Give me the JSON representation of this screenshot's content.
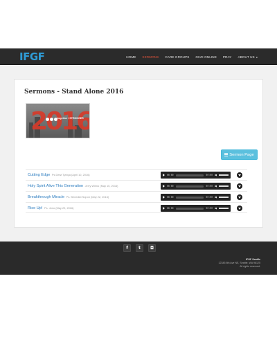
{
  "header": {
    "logo": "IFGF",
    "nav": [
      {
        "label": "HOME",
        "active": false
      },
      {
        "label": "SERMONS",
        "active": true
      },
      {
        "label": "CARE GROUPS",
        "active": false
      },
      {
        "label": "GIVE ONLINE",
        "active": false
      },
      {
        "label": "PRAY",
        "active": false
      },
      {
        "label": "ABOUT US",
        "active": false,
        "dropdown": true
      }
    ]
  },
  "main": {
    "title": "Sermons - Stand Alone 2016",
    "banner": {
      "year_text": "2016",
      "brand_text": "together / STRONGER"
    },
    "sermon_page_button": "Sermon Page",
    "sermons": [
      {
        "title": "Cutting Edge",
        "meta": "Ps Dewi Tjahya (April 10, 2016)",
        "time_start": "00:00",
        "time_end": "00:00"
      },
      {
        "title": "Holy Spirit Alive This Generation",
        "meta": "Jerry Wilmo (May 15, 2016)",
        "time_start": "00:00",
        "time_end": "00:00"
      },
      {
        "title": "Breakthrough Miracle",
        "meta": "Ps. Benedict Sopon (May 22, 2016)",
        "time_start": "00:00",
        "time_end": "00:00"
      },
      {
        "title": "Rise Up!",
        "meta": "Ps. Jono (May 29, 2016)",
        "time_start": "00:00",
        "time_end": "00:00"
      }
    ]
  },
  "footer": {
    "social": [
      {
        "icon": "facebook-icon",
        "glyph": "f"
      },
      {
        "icon": "twitter-icon",
        "glyph": "t"
      },
      {
        "icon": "instagram-icon",
        "glyph": "◘"
      }
    ],
    "org": "IFGF Seattle",
    "address": "12345 8th Ave NE, Seattle, WA 98125",
    "rights": "All rights reserved."
  },
  "colors": {
    "accent": "#e0533b",
    "link": "#2a7bbf",
    "button": "#5bc0de",
    "logo": "#2f9bd5"
  }
}
